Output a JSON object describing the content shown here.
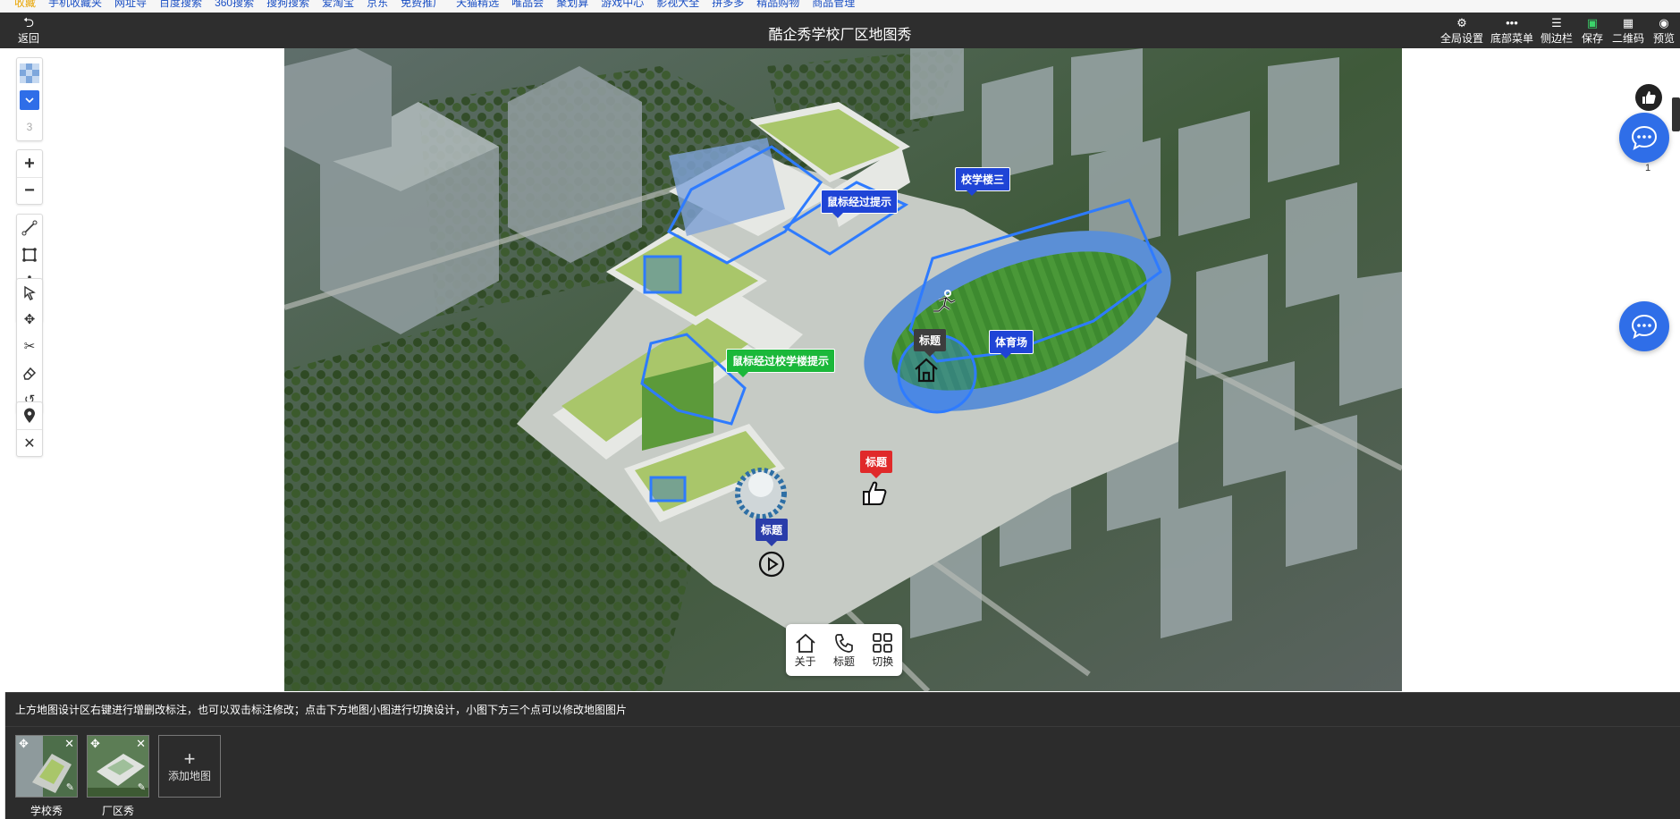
{
  "bookmarks": [
    "收藏",
    "手机收藏夹",
    "网址导",
    "百度搜索",
    "360搜索",
    "搜狗搜索",
    "爱淘宝",
    "京东",
    "免费推广",
    "天猫精选",
    "唯品会",
    "聚划算",
    "游戏中心",
    "影视大全",
    "拼多多",
    "精品购物",
    "商品管理"
  ],
  "header": {
    "back_label": "返回",
    "title": "酷企秀学校厂区地图秀",
    "buttons": [
      {
        "icon": "gear-icon",
        "label": "全局设置"
      },
      {
        "icon": "more-icon",
        "label": "底部菜单"
      },
      {
        "icon": "list-icon",
        "label": "侧边栏"
      },
      {
        "icon": "save-icon",
        "label": "保存"
      },
      {
        "icon": "qrcode-icon",
        "label": "二维码"
      },
      {
        "icon": "eye-icon",
        "label": "预览"
      }
    ]
  },
  "toolbar": {
    "layer_count": "3"
  },
  "map_labels": {
    "hover_hint_1": "鼠标经过提示",
    "building_3": "校学楼三",
    "sports_field": "体育场",
    "hover_hint_2": "鼠标经过校学楼提示",
    "title_gray": "标题",
    "title_red": "标题",
    "title_navy": "标题"
  },
  "bottom_menu": [
    {
      "icon": "home-icon",
      "label": "关于"
    },
    {
      "icon": "phone-icon",
      "label": "标题"
    },
    {
      "icon": "grid-icon",
      "label": "切换"
    }
  ],
  "sidebar_right": {
    "like_count": "1"
  },
  "status_text": "上方地图设计区右键进行增删改标注，也可以双击标注修改；点击下方地图小图进行切换设计，小图下方三个点可以修改地图图片",
  "maps": [
    {
      "name": "学校秀"
    },
    {
      "name": "厂区秀"
    }
  ],
  "add_map_label": "添加地图",
  "colors": {
    "topbar": "#2e2e2e",
    "accent_blue": "#2f6ee8",
    "label_blue": "#1f44d6",
    "label_green": "#1bb83a",
    "label_red": "#e02a2a"
  }
}
